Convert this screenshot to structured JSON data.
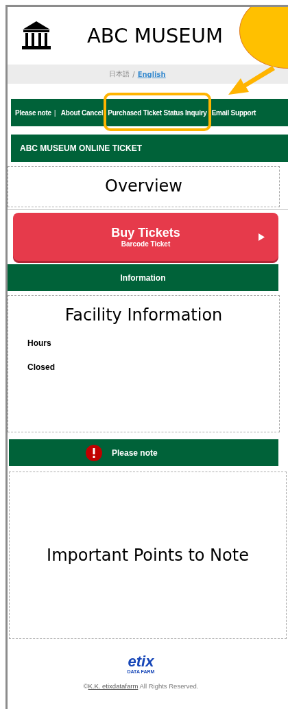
{
  "header": {
    "title": "ABC MUSEUM"
  },
  "language_bar": {
    "items": [
      {
        "label": "日本語",
        "selected": false
      },
      {
        "label": "English",
        "selected": true
      }
    ],
    "separator": "/"
  },
  "nav": {
    "items": [
      {
        "kind": "link",
        "label": "Please note",
        "highlighted": false
      },
      {
        "kind": "separator",
        "label": "|",
        "highlighted": false
      },
      {
        "kind": "link",
        "label": "About Cancel",
        "highlighted": false
      },
      {
        "kind": "link",
        "label": "Purchased Ticket Status Inquiry",
        "highlighted": true
      },
      {
        "kind": "link",
        "label": "Email Support",
        "highlighted": false
      }
    ]
  },
  "callout": {
    "shown": true
  },
  "site_title": "ABC MUSEUM ONLINE TICKET",
  "overview": {
    "title": "Overview"
  },
  "buy_button": {
    "label": "Buy Tickets",
    "sublabel": "Barcode Ticket"
  },
  "information": {
    "heading": "Information",
    "title": "Facility Information",
    "fields": [
      "Hours",
      "Closed"
    ]
  },
  "notes": {
    "heading": "Please note",
    "title": "Important Points to Note"
  },
  "footer": {
    "logo": "etix",
    "logo_sub": "DATA FARM",
    "company": "K.K. etixdatafarm",
    "rights": "All Rights Reserved.",
    "copyright_mark": "©"
  }
}
